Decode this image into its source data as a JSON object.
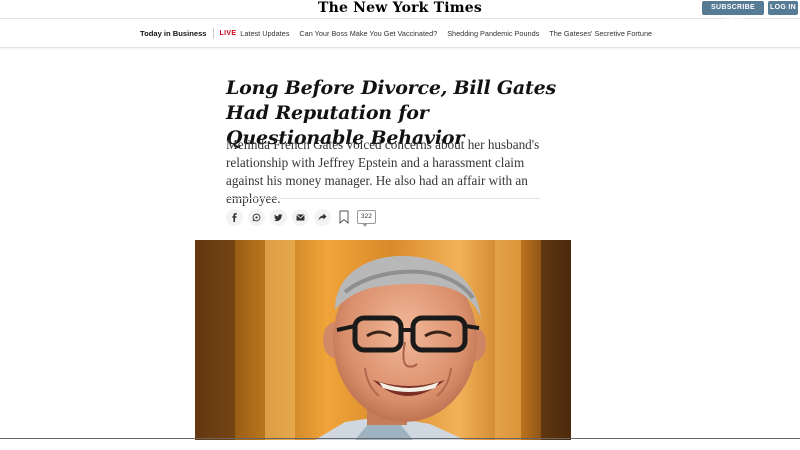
{
  "masthead": "The New York Times",
  "header": {
    "subscribe_label": "SUBSCRIBE NOW",
    "login_label": "LOG IN"
  },
  "section_nav": {
    "section": "Today in Business",
    "live_tag": "LIVE",
    "links": [
      "Latest Updates",
      "Can Your Boss Make You Get Vaccinated?",
      "Shedding Pandemic Pounds",
      "The Gateses' Secretive Fortune"
    ]
  },
  "article": {
    "headline": "Long Before Divorce, Bill Gates Had Reputation for Questionable Behavior",
    "summary": "Melinda French Gates voiced concerns about her husband's relationship with Jeffrey Epstein and a harassment claim against his money manager. He also had an affair with an employee.",
    "comment_count": "322"
  },
  "share": {
    "icons": [
      "facebook-icon",
      "whatsapp-icon",
      "twitter-icon",
      "email-icon",
      "share-icon",
      "bookmark-icon"
    ]
  }
}
